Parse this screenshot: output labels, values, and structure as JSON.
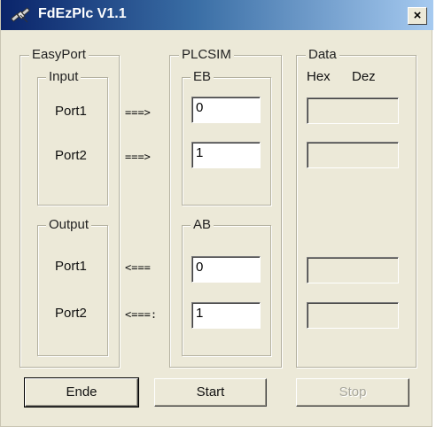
{
  "window": {
    "title": "FdEzPlc V1.1",
    "close_label": "×"
  },
  "easyport": {
    "legend": "EasyPort",
    "input": {
      "legend": "Input",
      "port1": "Port1",
      "port2": "Port2"
    },
    "output": {
      "legend": "Output",
      "port1": "Port1",
      "port2": "Port2"
    }
  },
  "arrows": {
    "in1": "===>",
    "in2": "===>",
    "out1": "<===",
    "out2": "<===:"
  },
  "plcsim": {
    "legend": "PLCSIM",
    "eb": {
      "legend": "EB",
      "field1": "0",
      "field2": "1"
    },
    "ab": {
      "legend": "AB",
      "field1": "0",
      "field2": "1"
    }
  },
  "data": {
    "legend": "Data",
    "hex_label": "Hex",
    "dez_label": "Dez",
    "fields": [
      "",
      "",
      "",
      ""
    ]
  },
  "buttons": {
    "ende": "Ende",
    "start": "Start",
    "stop": "Stop"
  }
}
